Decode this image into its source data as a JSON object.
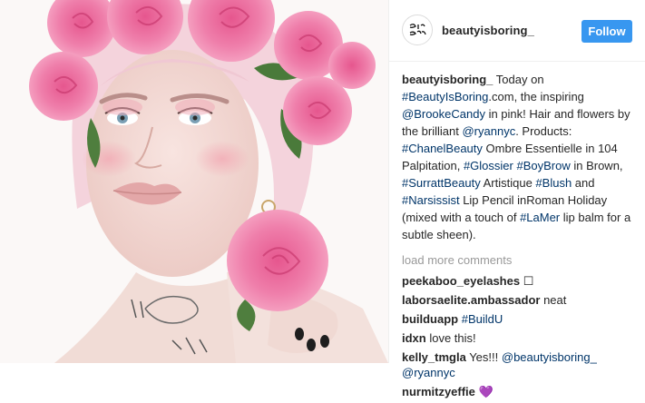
{
  "post": {
    "username": "beautyisboring_",
    "follow_label": "Follow",
    "avatar_icon": "beauty-is-boring-logo",
    "avatar_text": "Beauty is Boring"
  },
  "caption": {
    "username": "beautyisboring_",
    "t1": " Today on ",
    "l1": "#BeautyIsBoring",
    "t2": ".com, the inspiring ",
    "l2": "@BrookeCandy",
    "t3": " in pink! Hair and flowers by the brilliant ",
    "l3": "@ryannyc",
    "t4": ". Products: ",
    "l4": "#ChanelBeauty",
    "t5": " Ombre Essentielle in 104 Palpitation, ",
    "l5": "#Glossier",
    "t6": " ",
    "l6": "#BoyBrow",
    "t7": " in Brown, ",
    "l7": "#SurrattBeauty",
    "t8": " Artistique ",
    "l8": "#Blush",
    "t9": " and ",
    "l9": "#Narsissist",
    "t10": " Lip Pencil inRoman Holiday (mixed with a touch of ",
    "l10": "#LaMer",
    "t11": " lip balm for a subtle sheen)."
  },
  "load_more": "load more comments",
  "comments": [
    {
      "user": "peekaboo_eyelashes",
      "text": " ☐",
      "link": "",
      "text2": ""
    },
    {
      "user": "laborsaelite.ambassador",
      "text": " neat",
      "link": "",
      "text2": ""
    },
    {
      "user": "builduapp",
      "text": " ",
      "link": "#BuildU",
      "text2": ""
    },
    {
      "user": "idxn",
      "text": " love this!",
      "link": "",
      "text2": ""
    },
    {
      "user": "kelly_tmgla",
      "text": " Yes!!! ",
      "link": "@beautyisboring_ @ryannyc",
      "text2": ""
    },
    {
      "user": "nurmitzyeffie",
      "text": " 💜",
      "link": "",
      "text2": ""
    }
  ],
  "colors": {
    "link": "#003569",
    "follow_bg": "#3897f0",
    "muted": "#999999"
  }
}
